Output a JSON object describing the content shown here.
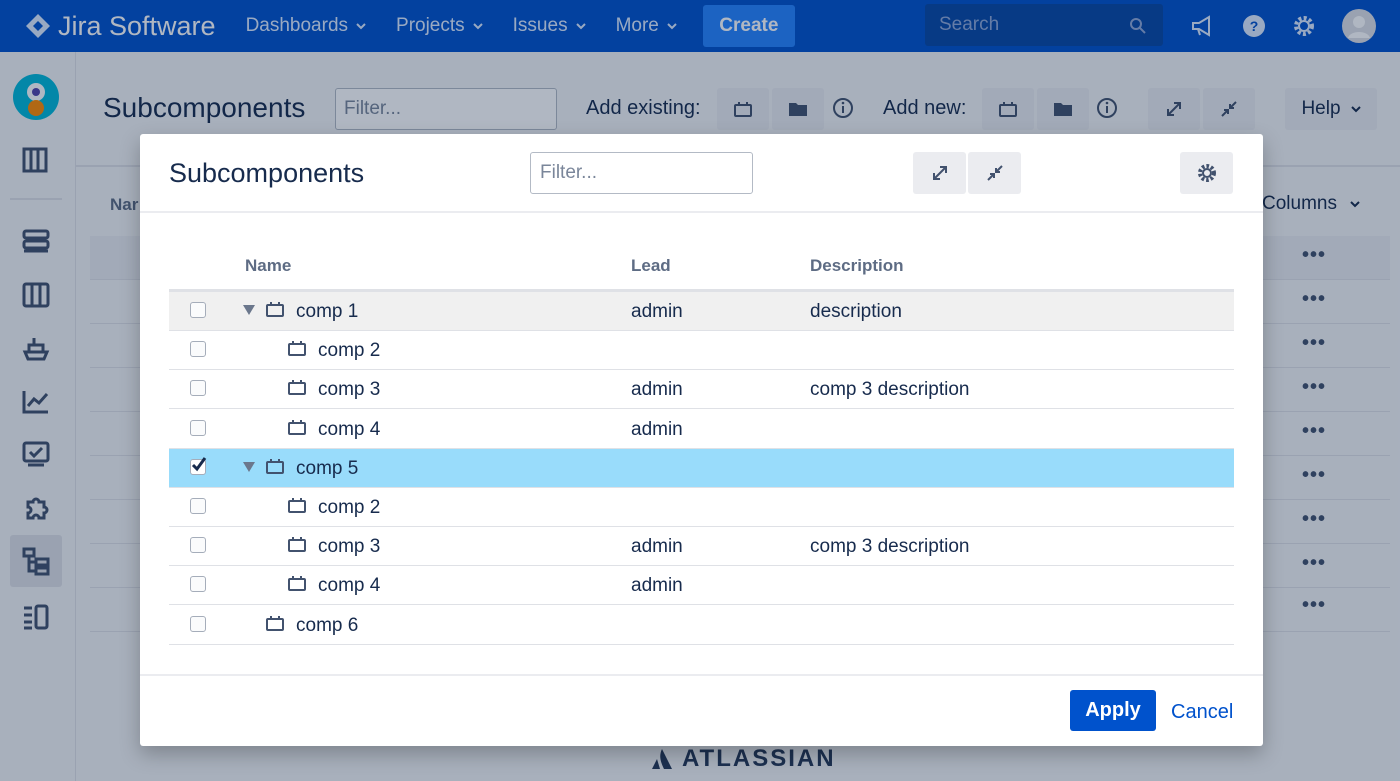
{
  "topnav": {
    "brand": "Jira Software",
    "items": [
      {
        "label": "Dashboards"
      },
      {
        "label": "Projects"
      },
      {
        "label": "Issues"
      },
      {
        "label": "More"
      }
    ],
    "create_label": "Create",
    "search_placeholder": "Search",
    "icons": [
      "megaphone-icon",
      "help-icon",
      "gear-icon",
      "user-avatar"
    ]
  },
  "sidebar": {
    "icons": [
      "project-avatar",
      "board-icon",
      "backlog-icon",
      "columns-icon",
      "releases-icon",
      "reports-icon",
      "issues-icon",
      "addons-icon",
      "components-icon",
      "list-icon"
    ]
  },
  "page": {
    "title": "Subcomponents",
    "filter_placeholder": "Filter...",
    "add_existing_label": "Add existing:",
    "add_new_label": "Add new:",
    "help_label": "Help",
    "columns_label": "Columns",
    "name_col_label": "Nar",
    "footer_brand": "ATLASSIAN"
  },
  "modal": {
    "title": "Subcomponents",
    "filter_placeholder": "Filter...",
    "columns": {
      "name": "Name",
      "lead": "Lead",
      "description": "Description"
    },
    "rows": [
      {
        "name": "comp 1",
        "lead": "admin",
        "description": "description",
        "depth": 0,
        "expanded": true,
        "checked": false
      },
      {
        "name": "comp 2",
        "lead": "",
        "description": "",
        "depth": 1,
        "expanded": false,
        "checked": false
      },
      {
        "name": "comp 3",
        "lead": "admin",
        "description": "comp 3 description",
        "depth": 1,
        "expanded": false,
        "checked": false
      },
      {
        "name": "comp 4",
        "lead": "admin",
        "description": "",
        "depth": 1,
        "expanded": false,
        "checked": false
      },
      {
        "name": "comp 5",
        "lead": "",
        "description": "",
        "depth": 0,
        "expanded": true,
        "checked": true
      },
      {
        "name": "comp 2",
        "lead": "",
        "description": "",
        "depth": 1,
        "expanded": false,
        "checked": false
      },
      {
        "name": "comp 3",
        "lead": "admin",
        "description": "comp 3 description",
        "depth": 1,
        "expanded": false,
        "checked": false
      },
      {
        "name": "comp 4",
        "lead": "admin",
        "description": "",
        "depth": 1,
        "expanded": false,
        "checked": false
      },
      {
        "name": "comp 6",
        "lead": "",
        "description": "",
        "depth": 0,
        "expanded": false,
        "checked": false
      }
    ],
    "apply_label": "Apply",
    "cancel_label": "Cancel"
  },
  "colors": {
    "nav": "#0052cc",
    "create": "#2684ff",
    "selected_row": "#99dcfb",
    "primary": "#0052cc"
  }
}
